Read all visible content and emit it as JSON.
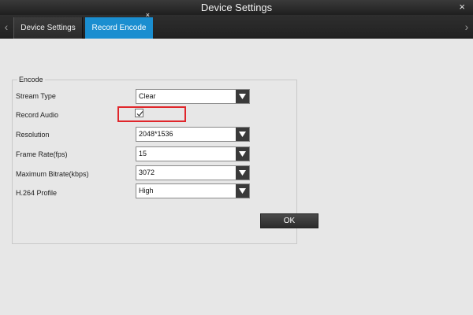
{
  "window": {
    "title": "Device Settings",
    "close_glyph": "×"
  },
  "tabs": [
    {
      "label": "Device Settings",
      "active": false
    },
    {
      "label": "Record Encode",
      "active": true,
      "close_glyph": "×"
    }
  ],
  "tab_nav": {
    "left_glyph": "‹",
    "right_glyph": "›"
  },
  "encode": {
    "group_label": "Encode",
    "stream_type": {
      "label": "Stream Type",
      "value": "Clear"
    },
    "record_audio": {
      "label": "Record Audio",
      "checked": true
    },
    "resolution": {
      "label": "Resolution",
      "value": "2048*1536"
    },
    "frame_rate": {
      "label": "Frame Rate(fps)",
      "value": "15"
    },
    "max_bitrate": {
      "label": "Maximum Bitrate(kbps)",
      "value": "3072"
    },
    "h264_profile": {
      "label": "H.264 Profile",
      "value": "High"
    }
  },
  "ok_label": "OK",
  "colors": {
    "accent_tab": "#1a8ed0",
    "highlight_box": "#e0262b",
    "titlebar": "#2b2b2b"
  },
  "icons": {
    "dropdown": "dropdown-arrow-icon",
    "check": "checkmark-icon"
  }
}
